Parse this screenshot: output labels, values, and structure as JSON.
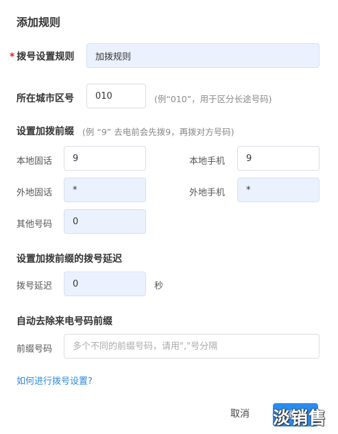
{
  "dialog": {
    "title": "添加规则",
    "rule": {
      "required_mark": "*",
      "label": "拨号设置规则",
      "value": "加拨规则"
    },
    "city_code": {
      "label": "所在城市区号",
      "value": "010",
      "hint": "(例“010”，用于区分长途号码)"
    },
    "prefix_section": {
      "title": "设置加拨前缀",
      "hint": "(例 “9” 去电前会先拨9，再拨对方号码)",
      "local_landline": {
        "label": "本地固话",
        "value": "9"
      },
      "local_mobile": {
        "label": "本地手机",
        "value": "9"
      },
      "remote_landline": {
        "label": "外地固话",
        "value": "*"
      },
      "remote_mobile": {
        "label": "外地手机",
        "value": "*"
      },
      "other": {
        "label": "其他号码",
        "value": "0"
      }
    },
    "delay_section": {
      "title": "设置加拨前缀的拨号延迟",
      "label": "拨号延迟",
      "value": "0",
      "unit": "秒"
    },
    "strip_section": {
      "title": "自动去除来电号码前缀",
      "label": "前缀号码",
      "placeholder": "多个不同的前缀号码，请用\",\"号分隔"
    },
    "help_link": "如何进行拨号设置?",
    "cancel_label": "取消",
    "ok_label": "确定",
    "watermark": "淡销售"
  }
}
